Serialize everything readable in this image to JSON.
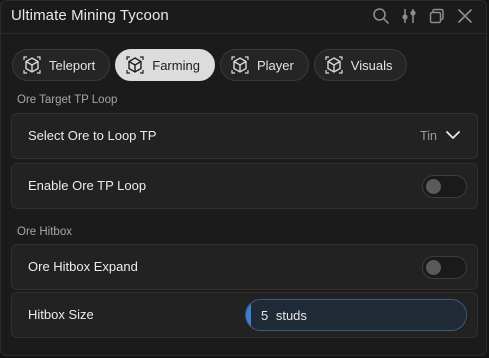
{
  "window": {
    "title": "Ultimate Mining Tycoon",
    "icons": [
      "search-icon",
      "sliders-icon",
      "minimize-icon",
      "close-icon"
    ]
  },
  "tabs": [
    {
      "label": "Teleport",
      "icon": "cube-icon",
      "active": false
    },
    {
      "label": "Farming",
      "icon": "cube-icon",
      "active": true
    },
    {
      "label": "Player",
      "icon": "cube-icon",
      "active": false
    },
    {
      "label": "Visuals",
      "icon": "cube-icon",
      "active": false
    }
  ],
  "sections": {
    "ore_target": {
      "label": "Ore Target TP Loop",
      "dropdown": {
        "label": "Select Ore to Loop TP",
        "value": "Tin"
      },
      "toggle": {
        "label": "Enable Ore TP Loop",
        "on": false
      }
    },
    "ore_hitbox": {
      "label": "Ore Hitbox",
      "toggle": {
        "label": "Ore Hitbox Expand",
        "on": false
      },
      "slider": {
        "label": "Hitbox Size",
        "value_text": "5 studs",
        "value": 5,
        "fraction": 0.02
      }
    }
  },
  "colors": {
    "accent": "#3d7fcf",
    "background": "#1b1b1b",
    "row": "#222222",
    "active_tab": "#dcdcdc"
  }
}
